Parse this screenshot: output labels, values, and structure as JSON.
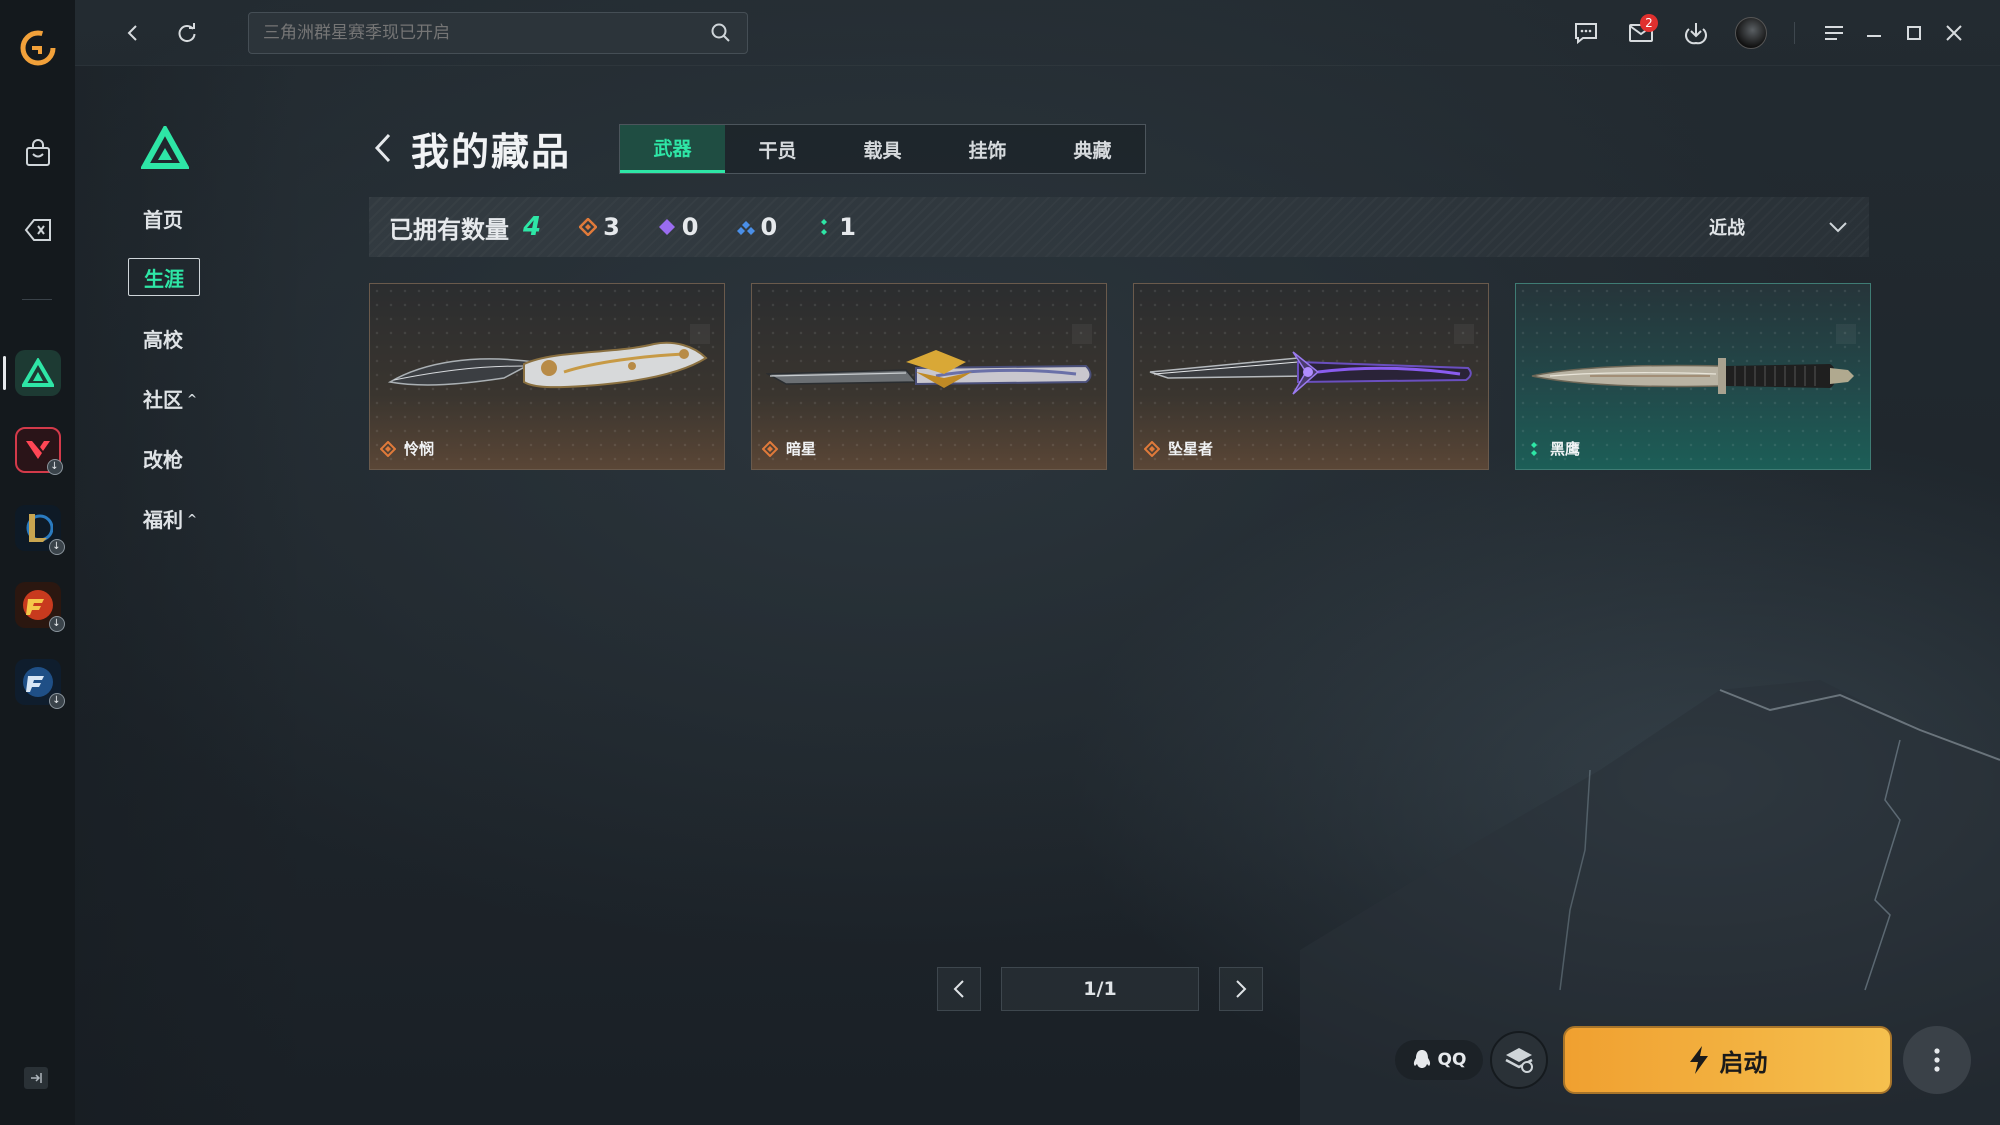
{
  "topbar": {
    "search_placeholder": "三角洲群星赛季现已开启",
    "mail_badge": "2"
  },
  "game_nav": {
    "items": [
      {
        "label": "首页",
        "caret": ""
      },
      {
        "label": "生涯",
        "caret": "",
        "active": true
      },
      {
        "label": "高校",
        "caret": ""
      },
      {
        "label": "社区",
        "caret": "^"
      },
      {
        "label": "改枪",
        "caret": ""
      },
      {
        "label": "福利",
        "caret": "^"
      }
    ]
  },
  "main": {
    "title": "我的藏品",
    "tabs": [
      {
        "label": "武器",
        "active": true
      },
      {
        "label": "干员"
      },
      {
        "label": "载具"
      },
      {
        "label": "挂饰"
      },
      {
        "label": "典藏"
      }
    ],
    "stats": {
      "owned_label": "已拥有数量",
      "owned_count": "4",
      "rarity": [
        {
          "icon": "orange-gem-icon",
          "color": "#e07a3a",
          "value": "3"
        },
        {
          "icon": "purple-gem-icon",
          "color": "#9a6cf0",
          "value": "0"
        },
        {
          "icon": "blue-gem-icon",
          "color": "#4a8fe8",
          "value": "0"
        },
        {
          "icon": "green-gem-icon",
          "color": "#2ee6a6",
          "value": "1"
        }
      ]
    },
    "filter": {
      "selected": "近战"
    },
    "items": [
      {
        "name": "怜悯",
        "rarity_color": "#e07a3a"
      },
      {
        "name": "暗星",
        "rarity_color": "#e07a3a"
      },
      {
        "name": "坠星者",
        "rarity_color": "#e07a3a"
      },
      {
        "name": "黑鹰",
        "rarity_color": "#2ee6a6"
      }
    ]
  },
  "pager": {
    "page": "1/1"
  },
  "bottom": {
    "qq_label": "QQ",
    "launch_label": "启动"
  },
  "colors": {
    "accent": "#2ee6a6",
    "launch": "#f5b043"
  }
}
